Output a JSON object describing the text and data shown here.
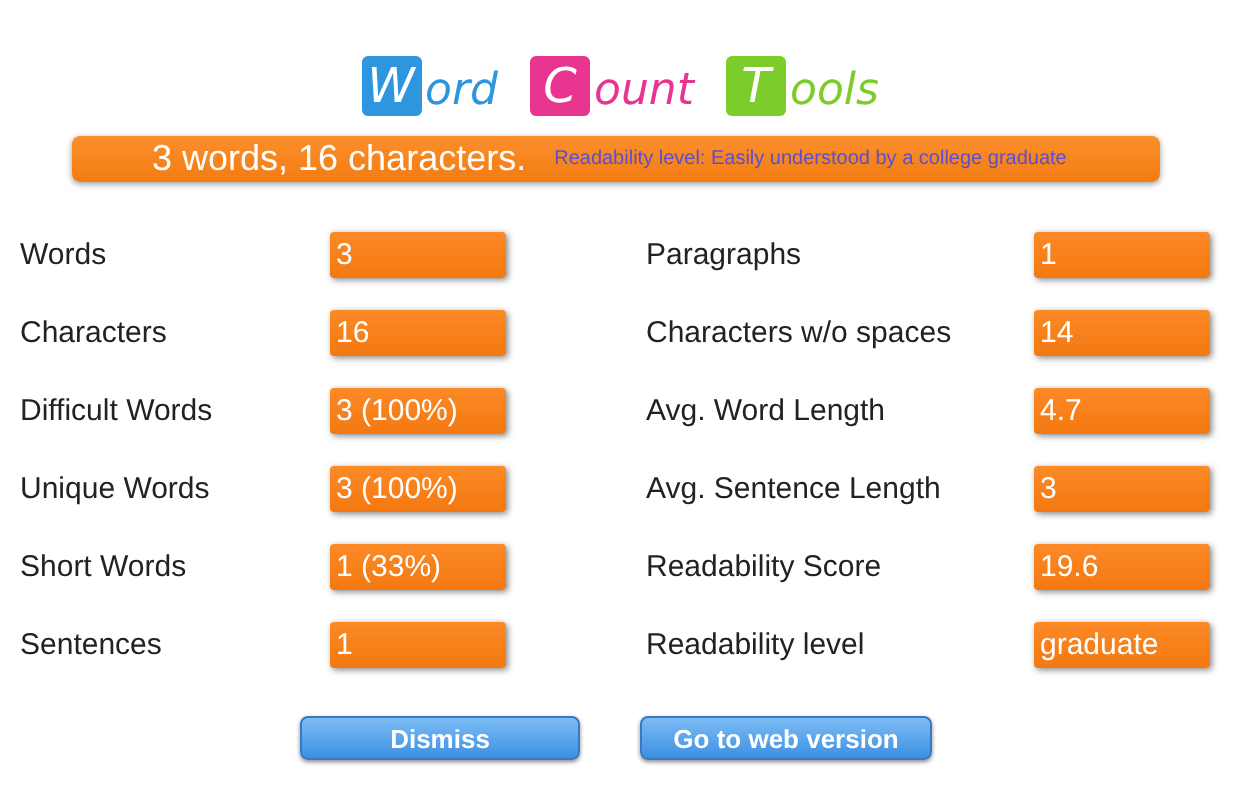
{
  "logo": [
    {
      "initial": "W",
      "rest": "ord",
      "color": "#2e96de"
    },
    {
      "initial": "C",
      "rest": "ount",
      "color": "#e8358f"
    },
    {
      "initial": "T",
      "rest": "ools",
      "color": "#7ccc2c"
    }
  ],
  "summary": {
    "headline": "3 words, 16 characters.",
    "readability": "Readability level: Easily understood by a college graduate"
  },
  "stats": [
    {
      "label": "Words",
      "value": "3"
    },
    {
      "label": "Paragraphs",
      "value": "1"
    },
    {
      "label": "Characters",
      "value": "16"
    },
    {
      "label": "Characters w/o spaces",
      "value": "14"
    },
    {
      "label": "Difficult Words",
      "value": "3 (100%)"
    },
    {
      "label": "Avg. Word Length",
      "value": "4.7"
    },
    {
      "label": "Unique Words",
      "value": "3 (100%)"
    },
    {
      "label": "Avg. Sentence Length",
      "value": "3"
    },
    {
      "label": "Short Words",
      "value": "1 (33%)"
    },
    {
      "label": "Readability Score",
      "value": "19.6"
    },
    {
      "label": "Sentences",
      "value": "1"
    },
    {
      "label": "Readability level",
      "value": "graduate"
    }
  ],
  "buttons": [
    "Dismiss",
    "Go to web version"
  ]
}
